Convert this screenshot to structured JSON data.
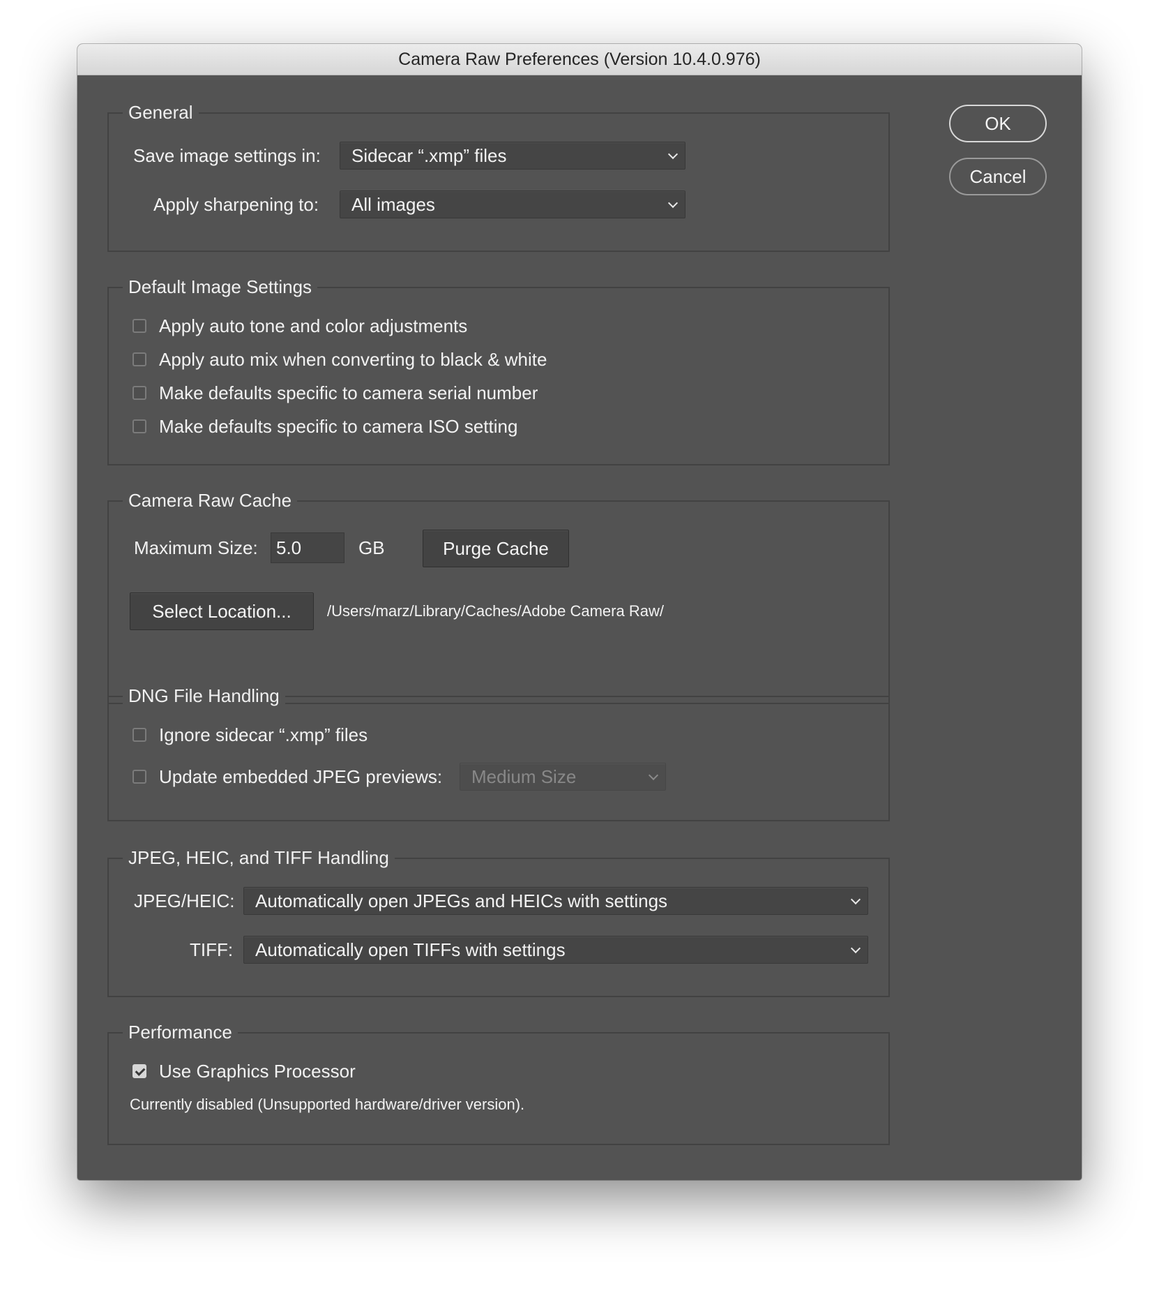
{
  "window": {
    "title": "Camera Raw Preferences  (Version 10.4.0.976)"
  },
  "buttons": {
    "ok": "OK",
    "cancel": "Cancel"
  },
  "general": {
    "title": "General",
    "save_label": "Save image settings in:",
    "save_value": "Sidecar “.xmp” files",
    "sharpen_label": "Apply sharpening to:",
    "sharpen_value": "All images"
  },
  "default_image": {
    "title": "Default Image Settings",
    "options": [
      {
        "label": "Apply auto tone and color adjustments",
        "checked": false
      },
      {
        "label": "Apply auto mix when converting to black & white",
        "checked": false
      },
      {
        "label": "Make defaults specific to camera serial number",
        "checked": false
      },
      {
        "label": "Make defaults specific to camera ISO setting",
        "checked": false
      }
    ]
  },
  "cache": {
    "title": "Camera Raw Cache",
    "max_label": "Maximum Size:",
    "max_value": "5.0",
    "unit": "GB",
    "purge": "Purge Cache",
    "select_location": "Select Location...",
    "path": "/Users/marz/Library/Caches/Adobe Camera Raw/"
  },
  "dng": {
    "title": "DNG File Handling",
    "ignore_label": "Ignore sidecar “.xmp” files",
    "ignore_checked": false,
    "update_label": "Update embedded JPEG previews:",
    "update_checked": false,
    "preview_size": "Medium Size"
  },
  "jpeg_tiff": {
    "title": "JPEG, HEIC, and TIFF Handling",
    "jpeg_label": "JPEG/HEIC:",
    "jpeg_value": "Automatically open JPEGs and HEICs with settings",
    "tiff_label": "TIFF:",
    "tiff_value": "Automatically open TIFFs with settings"
  },
  "performance": {
    "title": "Performance",
    "gpu_label": "Use Graphics Processor",
    "gpu_checked": true,
    "status": "Currently disabled (Unsupported hardware/driver version)."
  }
}
